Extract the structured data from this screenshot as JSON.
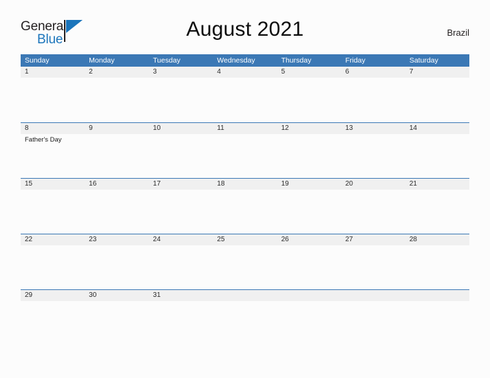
{
  "logo": {
    "word_one": "General",
    "word_two": "Blue",
    "flag_color": "#1b75bb"
  },
  "header": {
    "title": "August 2021",
    "region": "Brazil"
  },
  "calendar": {
    "weekdays": [
      "Sunday",
      "Monday",
      "Tuesday",
      "Wednesday",
      "Thursday",
      "Friday",
      "Saturday"
    ],
    "header_bg": "#3b78b5",
    "day_strip_bg": "#f0f0f0",
    "weeks": [
      [
        {
          "date": "1",
          "events": []
        },
        {
          "date": "2",
          "events": []
        },
        {
          "date": "3",
          "events": []
        },
        {
          "date": "4",
          "events": []
        },
        {
          "date": "5",
          "events": []
        },
        {
          "date": "6",
          "events": []
        },
        {
          "date": "7",
          "events": []
        }
      ],
      [
        {
          "date": "8",
          "events": [
            "Father's Day"
          ]
        },
        {
          "date": "9",
          "events": []
        },
        {
          "date": "10",
          "events": []
        },
        {
          "date": "11",
          "events": []
        },
        {
          "date": "12",
          "events": []
        },
        {
          "date": "13",
          "events": []
        },
        {
          "date": "14",
          "events": []
        }
      ],
      [
        {
          "date": "15",
          "events": []
        },
        {
          "date": "16",
          "events": []
        },
        {
          "date": "17",
          "events": []
        },
        {
          "date": "18",
          "events": []
        },
        {
          "date": "19",
          "events": []
        },
        {
          "date": "20",
          "events": []
        },
        {
          "date": "21",
          "events": []
        }
      ],
      [
        {
          "date": "22",
          "events": []
        },
        {
          "date": "23",
          "events": []
        },
        {
          "date": "24",
          "events": []
        },
        {
          "date": "25",
          "events": []
        },
        {
          "date": "26",
          "events": []
        },
        {
          "date": "27",
          "events": []
        },
        {
          "date": "28",
          "events": []
        }
      ],
      [
        {
          "date": "29",
          "events": []
        },
        {
          "date": "30",
          "events": []
        },
        {
          "date": "31",
          "events": []
        },
        {
          "date": "",
          "events": []
        },
        {
          "date": "",
          "events": []
        },
        {
          "date": "",
          "events": []
        },
        {
          "date": "",
          "events": []
        }
      ]
    ]
  }
}
